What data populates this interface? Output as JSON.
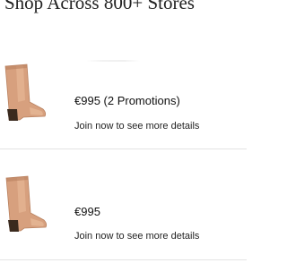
{
  "header": {
    "title": "Shop Across 800+ Stores"
  },
  "products": [
    {
      "image_icon": "cowboy-boot-image",
      "price_text": "€995 (2 Promotions)",
      "cta_text": "Join now to see more details"
    },
    {
      "image_icon": "cowboy-boot-image",
      "price_text": "€995",
      "cta_text": "Join now to see more details"
    }
  ],
  "colors": {
    "boot_leather": "#d7a07e",
    "boot_heel": "#3a2a1e",
    "divider": "#e3e3e3"
  }
}
